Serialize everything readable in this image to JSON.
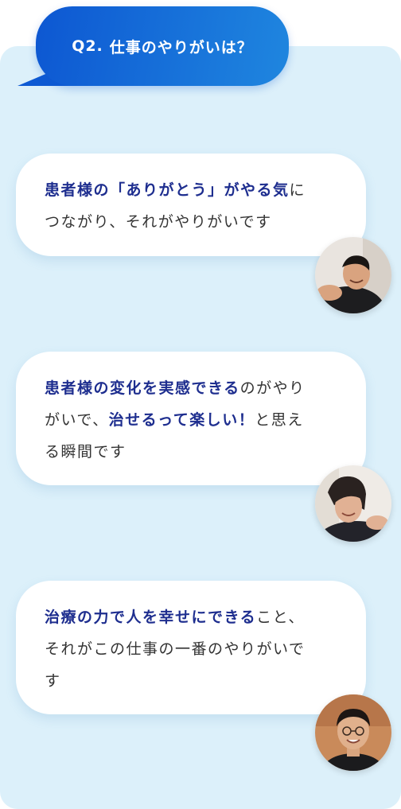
{
  "question": {
    "number": "Q2.",
    "text": "仕事のやりがいは？"
  },
  "answers": [
    {
      "segments": [
        {
          "text": "患者様の「ありがとう」がやる気",
          "highlight": true
        },
        {
          "text": "に",
          "highlight": false
        },
        {
          "br": true
        },
        {
          "text": "つながり、それがやりがいです",
          "highlight": false
        }
      ],
      "avatar": "staff-photo-male-smiling"
    },
    {
      "segments": [
        {
          "text": "患者様の変化を実感できる",
          "highlight": true
        },
        {
          "text": "のがやり",
          "highlight": false
        },
        {
          "br": true
        },
        {
          "text": "がいで、",
          "highlight": false
        },
        {
          "text": "治せるって楽しい！",
          "highlight": true
        },
        {
          "text": "と思え",
          "highlight": false
        },
        {
          "br": true
        },
        {
          "text": "る瞬間です",
          "highlight": false
        }
      ],
      "avatar": "staff-photo-female-smiling"
    },
    {
      "segments": [
        {
          "text": "治療の力で人を幸せにできる",
          "highlight": true
        },
        {
          "text": "こと、",
          "highlight": false
        },
        {
          "br": true
        },
        {
          "text": "それがこの仕事の一番のやりがいで",
          "highlight": false
        },
        {
          "br": true
        },
        {
          "text": "す",
          "highlight": false
        }
      ],
      "avatar": "staff-photo-male-glasses"
    }
  ],
  "colors": {
    "accent": "#1e2e8f",
    "question_gradient_start": "#0d57d2",
    "question_gradient_end": "#1f86df",
    "panel_background": "#dcf0fa",
    "body_text": "#333333"
  }
}
